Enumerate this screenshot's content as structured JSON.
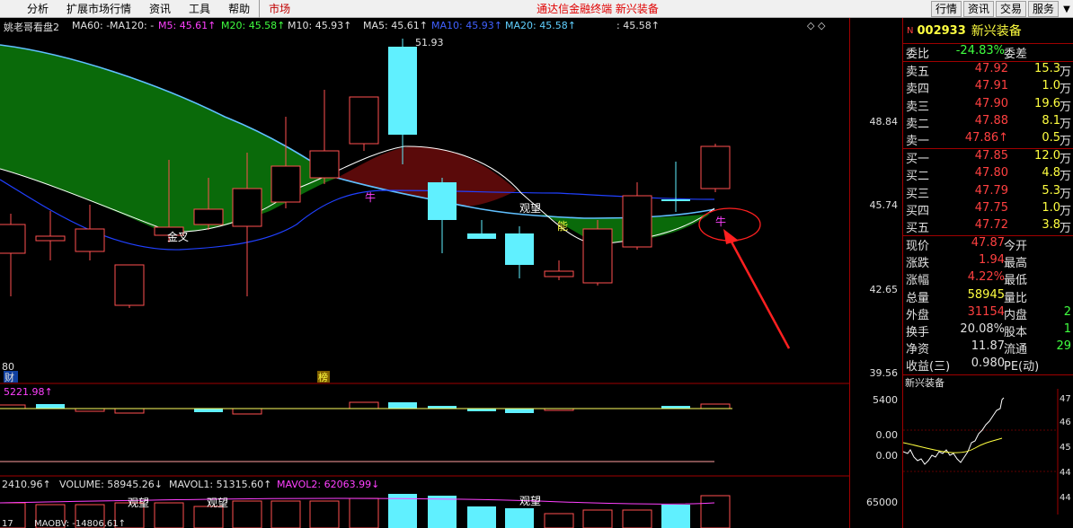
{
  "menu": {
    "items": [
      "",
      "分析",
      "扩展市场行情",
      "资讯",
      "工具",
      "帮助"
    ],
    "active_item": "市场",
    "center_title": "通达信金融终端  新兴装备",
    "right_buttons": [
      "行情",
      "资讯",
      "交易",
      "服务"
    ]
  },
  "chart_header": {
    "indicator": "姚老哥看盘2",
    "ma60": "MA60: -",
    "ma120": "MA120: -",
    "m5": "M5: 45.61↑",
    "m20": "M20: 45.58↑",
    "m10": "M10: 45.93↑",
    "ma5": "MA5: 45.61↑",
    "ma10": "MA10: 45.93↑",
    "ma20": "MA20: 45.58↑",
    "extra": ": 45.58↑",
    "high_mark": "51.93"
  },
  "price_axis": [
    "48.84",
    "45.74",
    "42.65",
    "39.56"
  ],
  "chart_annotations": {
    "golden_cross": "金叉",
    "watch": "观望",
    "bull": "牛",
    "able": "能",
    "fin": "财",
    "rank": "榜",
    "left_num": "80"
  },
  "sub_panel1": {
    "value": "5221.98↑",
    "axis": [
      "5400",
      "0.00",
      "0.00"
    ]
  },
  "volume_panel": {
    "left": "2410.96↑",
    "volume": "VOLUME: 58945.26↓",
    "mavol1": "MAVOL1: 51315.60↑",
    "mavol2": "MAVOL2: 62063.99↓",
    "axis": "65000",
    "watch_labels": [
      "观望",
      "观望",
      "观望"
    ],
    "bottom_left": "17",
    "maobv": "MAOBV: -14806.61↑"
  },
  "stock": {
    "code": "002933",
    "name": "新兴装备",
    "wei_bi_label": "委比",
    "wei_bi": "-24.83%",
    "wei_cha_label": "委差",
    "asks": [
      {
        "label": "卖五",
        "price": "47.92",
        "vol": "15.3",
        "unit": "万"
      },
      {
        "label": "卖四",
        "price": "47.91",
        "vol": "1.0",
        "unit": "万"
      },
      {
        "label": "卖三",
        "price": "47.90",
        "vol": "19.6",
        "unit": "万"
      },
      {
        "label": "卖二",
        "price": "47.88",
        "vol": "8.1",
        "unit": "万"
      },
      {
        "label": "卖一",
        "price": "47.86↑",
        "vol": "0.5",
        "unit": "万"
      }
    ],
    "bids": [
      {
        "label": "买一",
        "price": "47.85",
        "vol": "12.0",
        "unit": "万"
      },
      {
        "label": "买二",
        "price": "47.80",
        "vol": "4.8",
        "unit": "万"
      },
      {
        "label": "买三",
        "price": "47.79",
        "vol": "5.3",
        "unit": "万"
      },
      {
        "label": "买四",
        "price": "47.75",
        "vol": "1.0",
        "unit": "万"
      },
      {
        "label": "买五",
        "price": "47.72",
        "vol": "3.8",
        "unit": "万"
      }
    ],
    "stats": [
      {
        "l1": "现价",
        "v1": "47.87",
        "c1": "red",
        "l2": "今开",
        "v2": ""
      },
      {
        "l1": "涨跌",
        "v1": "1.94",
        "c1": "red",
        "l2": "最高",
        "v2": ""
      },
      {
        "l1": "涨幅",
        "v1": "4.22%",
        "c1": "red",
        "l2": "最低",
        "v2": ""
      },
      {
        "l1": "总量",
        "v1": "58945",
        "c1": "yel",
        "l2": "量比",
        "v2": ""
      },
      {
        "l1": "外盘",
        "v1": "31154",
        "c1": "red",
        "l2": "内盘",
        "v2": "2"
      },
      {
        "l1": "换手",
        "v1": "20.08%",
        "c1": "wht",
        "l2": "股本",
        "v2": "1"
      },
      {
        "l1": "净资",
        "v1": "11.87",
        "c1": "wht",
        "l2": "流通",
        "v2": "29"
      },
      {
        "l1": "收益(三)",
        "v1": "0.980",
        "c1": "wht",
        "l2": "PE(动)",
        "v2": ""
      }
    ],
    "mini_chart_title": "新兴装备",
    "mini_axis": [
      "47",
      "46",
      "45",
      "44",
      "44"
    ]
  },
  "colors": {
    "up": "#ff4040",
    "down": "#60f0ff",
    "green_fill": "#0a6a0a",
    "red_fill": "#5a0a0a",
    "arrow": "#ff2020"
  }
}
